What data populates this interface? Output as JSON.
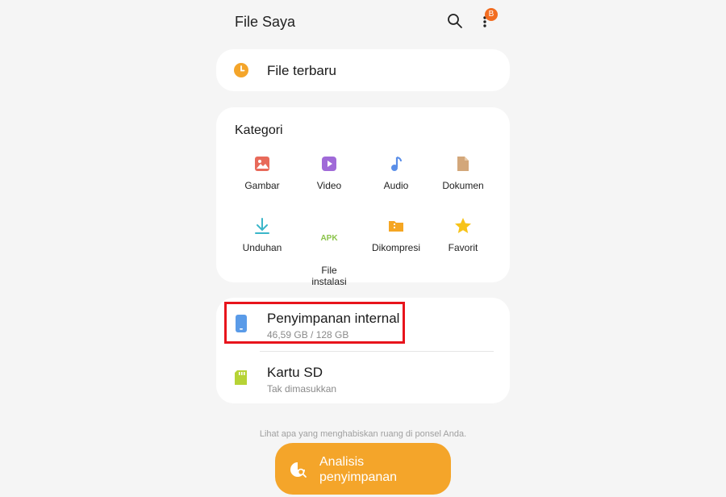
{
  "header": {
    "title": "File Saya",
    "badge": "B"
  },
  "recent": {
    "label": "File terbaru"
  },
  "categories": {
    "heading": "Kategori",
    "items": [
      {
        "label": "Gambar",
        "icon": "image-icon",
        "color": "#e86a5a"
      },
      {
        "label": "Video",
        "icon": "video-icon",
        "color": "#a06ad8"
      },
      {
        "label": "Audio",
        "icon": "audio-icon",
        "color": "#5a8ee8"
      },
      {
        "label": "Dokumen",
        "icon": "document-icon",
        "color": "#d3a77a"
      },
      {
        "label": "Unduhan",
        "icon": "download-icon",
        "color": "#3bb6c9"
      },
      {
        "label": "File\ninstalasi",
        "icon": "apk-icon",
        "color": "#8bc34a",
        "glyph": "APK"
      },
      {
        "label": "Dikompresi",
        "icon": "zip-folder-icon",
        "color": "#f5a623"
      },
      {
        "label": "Favorit",
        "icon": "star-icon",
        "color": "#f7c319"
      }
    ]
  },
  "storage": {
    "internal": {
      "name": "Penyimpanan internal",
      "usage": "46,59 GB / 128 GB",
      "icon": "phone-icon",
      "color": "#5a9be8"
    },
    "sd": {
      "name": "Kartu SD",
      "status": "Tak dimasukkan",
      "icon": "sd-card-icon",
      "color": "#b6d335"
    }
  },
  "hint": "Lihat apa yang menghabiskan ruang di ponsel Anda.",
  "analyze": {
    "label_line1": "Analisis",
    "label_line2": "penyimpanan"
  },
  "colors": {
    "accent": "#f4a52a",
    "highlight": "#e8141c",
    "badge": "#f26d21"
  }
}
